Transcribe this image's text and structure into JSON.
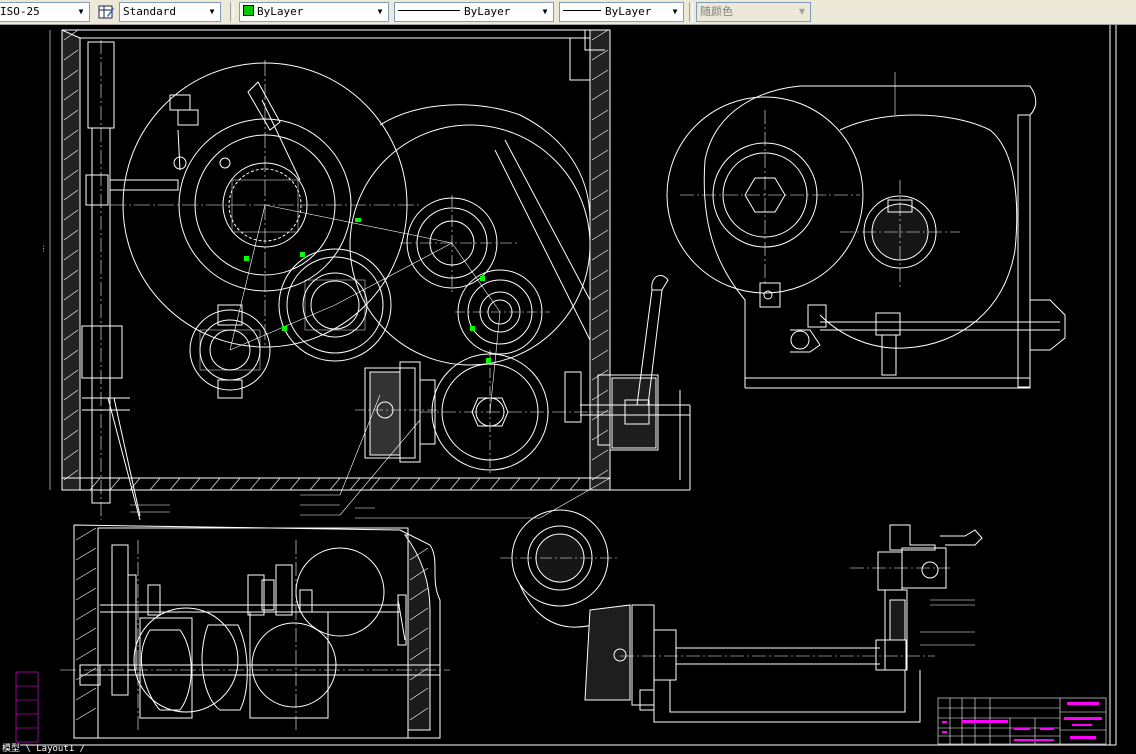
{
  "toolbar": {
    "text_style": "ISO-25",
    "table_style": "Standard",
    "layer": "ByLayer",
    "linetype": "ByLayer",
    "lineweight": "ByLayer",
    "plot_style": "随颜色"
  },
  "colors": {
    "background": "#000000",
    "drawing_lines": "#ffffff",
    "layer_swatch": "#00cc00",
    "dimension_green": "#00ff00",
    "titleblock_magenta": "#ff00ff"
  },
  "status": {
    "layout_tabs": "模型 \\ Layout1 /"
  }
}
